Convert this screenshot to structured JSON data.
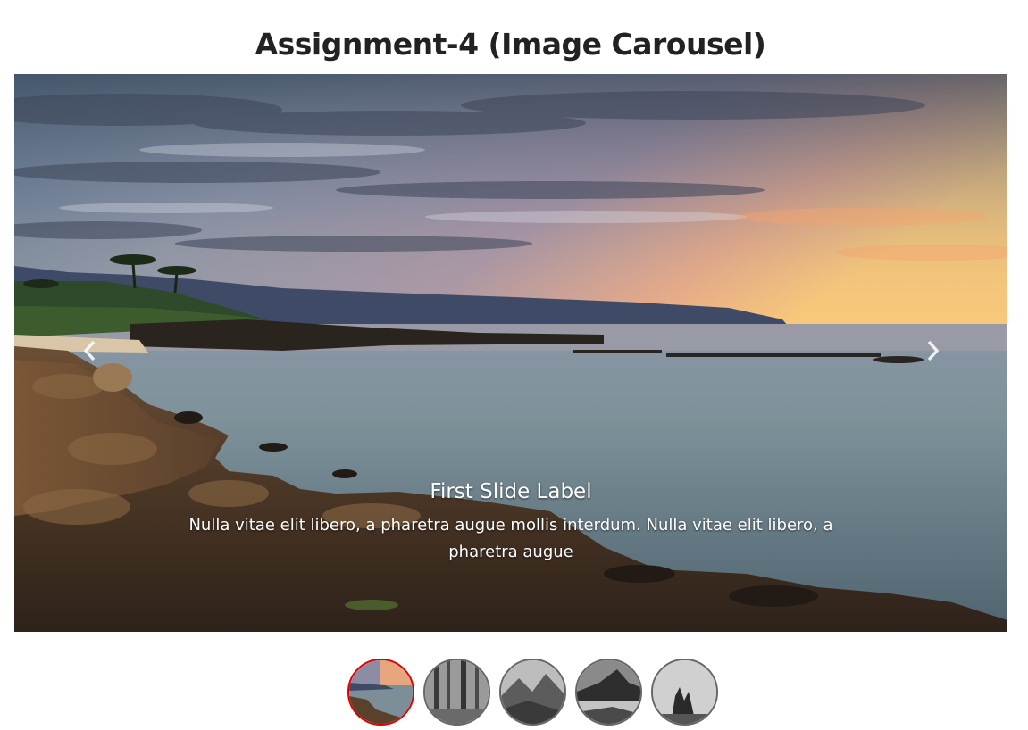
{
  "page": {
    "title": "Assignment-4 (Image Carousel)"
  },
  "carousel": {
    "active_index": 0,
    "slide": {
      "label": "First Slide Label",
      "text": "Nulla vitae elit libero, a pharetra augue mollis interdum. Nulla vitae elit libero, a pharetra augue"
    },
    "prev_icon": "chevron-left-icon",
    "next_icon": "chevron-right-icon"
  },
  "thumbnails": [
    {
      "name": "thumbnail-sunset-coast",
      "active": true
    },
    {
      "name": "thumbnail-forest",
      "active": false
    },
    {
      "name": "thumbnail-mountains",
      "active": false
    },
    {
      "name": "thumbnail-mountain-lake",
      "active": false
    },
    {
      "name": "thumbnail-rock-spire",
      "active": false
    }
  ],
  "colors": {
    "active_border": "#e00000",
    "inactive_border": "#666666",
    "title": "#222222"
  }
}
